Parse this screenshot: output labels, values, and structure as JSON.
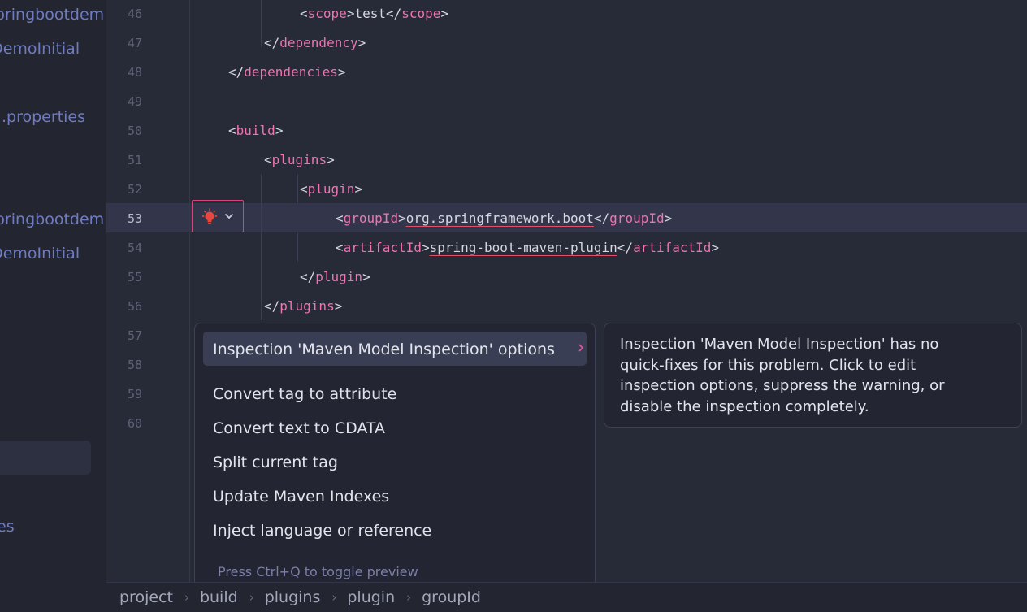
{
  "sidebar": {
    "items": [
      {
        "label": "springbootdem"
      },
      {
        "label": "otDemoInitial"
      },
      {
        "label": ".properties"
      },
      {
        "label": "springbootdem"
      },
      {
        "label": "otDemoInitial"
      },
      {
        "label": "es"
      }
    ]
  },
  "editor": {
    "line_numbers": [
      "46",
      "47",
      "48",
      "49",
      "50",
      "51",
      "52",
      "53",
      "54",
      "55",
      "56",
      "57",
      "58",
      "59",
      "60"
    ],
    "current_line": "53",
    "lines": {
      "l46": {
        "open": "<",
        "tag": "scope",
        "close": ">",
        "text": "test",
        "end_open": "</",
        "end_tag": "scope",
        "end_close": ">"
      },
      "l47": {
        "open": "</",
        "tag": "dependency",
        "close": ">"
      },
      "l48": {
        "open": "</",
        "tag": "dependencies",
        "close": ">"
      },
      "l50": {
        "open": "<",
        "tag": "build",
        "close": ">"
      },
      "l51": {
        "open": "<",
        "tag": "plugins",
        "close": ">"
      },
      "l52": {
        "open": "<",
        "tag": "plugin",
        "close": ">"
      },
      "l53": {
        "open": "<",
        "tag": "groupId",
        "close": ">",
        "text": "org.springframework.boot",
        "end_open": "</",
        "end_tag": "groupId",
        "end_close": ">"
      },
      "l54": {
        "open": "<",
        "tag": "artifactId",
        "close": ">",
        "text": "spring-boot-maven-plugin",
        "end_open": "</",
        "end_tag": "artifactId",
        "end_close": ">"
      },
      "l55": {
        "open": "</",
        "tag": "plugin",
        "close": ">"
      },
      "l56": {
        "open": "</",
        "tag": "plugins",
        "close": ">"
      }
    },
    "colors": {
      "tag": "#ee74b2",
      "text": "#d5d7e1",
      "line_number": "#5e6378",
      "bulb": "#e8473f"
    }
  },
  "popup": {
    "items": [
      {
        "label": "Inspection 'Maven Model Inspection' options",
        "has_submenu": true,
        "selected": true
      },
      {
        "label": "Convert tag to attribute"
      },
      {
        "label": "Convert text to CDATA"
      },
      {
        "label": "Split current tag"
      },
      {
        "label": "Update Maven Indexes"
      },
      {
        "label": "Inject language or reference"
      }
    ],
    "hint": "Press Ctrl+Q to toggle preview"
  },
  "description": {
    "text": "Inspection 'Maven Model Inspection' has no quick-fixes for this problem. Click to edit inspection options, suppress the warning, or disable the inspection completely."
  },
  "breadcrumb": {
    "items": [
      "project",
      "build",
      "plugins",
      "plugin",
      "groupId"
    ]
  }
}
